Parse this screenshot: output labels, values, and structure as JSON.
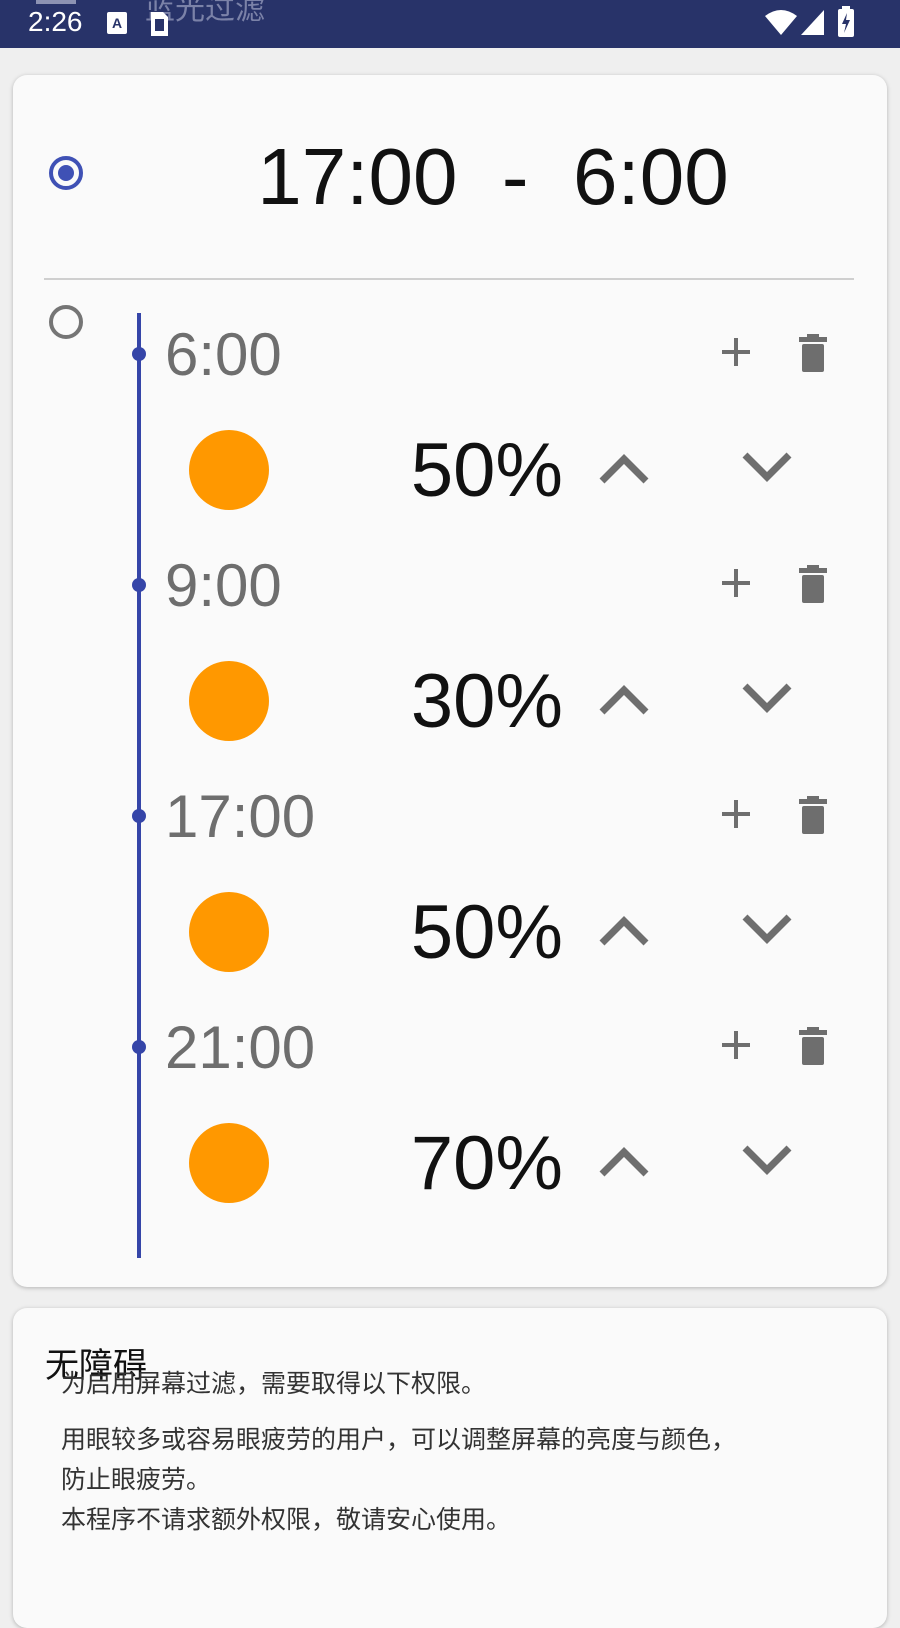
{
  "status_bar": {
    "time": "2:26",
    "app_title_partial": "蓝光过滤",
    "icons": [
      "a-notification-icon",
      "sim-notification-icon",
      "wifi-icon",
      "signal-icon",
      "battery-icon"
    ]
  },
  "schedule_range": {
    "start": "17:00",
    "separator": "-",
    "end": "6:00",
    "selected": true
  },
  "timeline": {
    "selected": false,
    "slots": [
      {
        "time": "6:00",
        "percent": "50%"
      },
      {
        "time": "9:00",
        "percent": "30%"
      },
      {
        "time": "17:00",
        "percent": "50%"
      },
      {
        "time": "21:00",
        "percent": "70%"
      }
    ]
  },
  "accessibility": {
    "title": "无障碍",
    "line1": "为启用屏幕过滤，需要取得以下权限。",
    "line2": "用眼较多或容易眼疲劳的用户，可以调整屏幕的亮度与颜色，",
    "line3": "防止眼疲劳。",
    "line4": "本程序不请求额外权限，敬请安心使用。"
  },
  "colors": {
    "status_bar": "#283369",
    "accent": "#3f51b5",
    "timeline": "#3545a8",
    "sun": "#ff9800"
  }
}
